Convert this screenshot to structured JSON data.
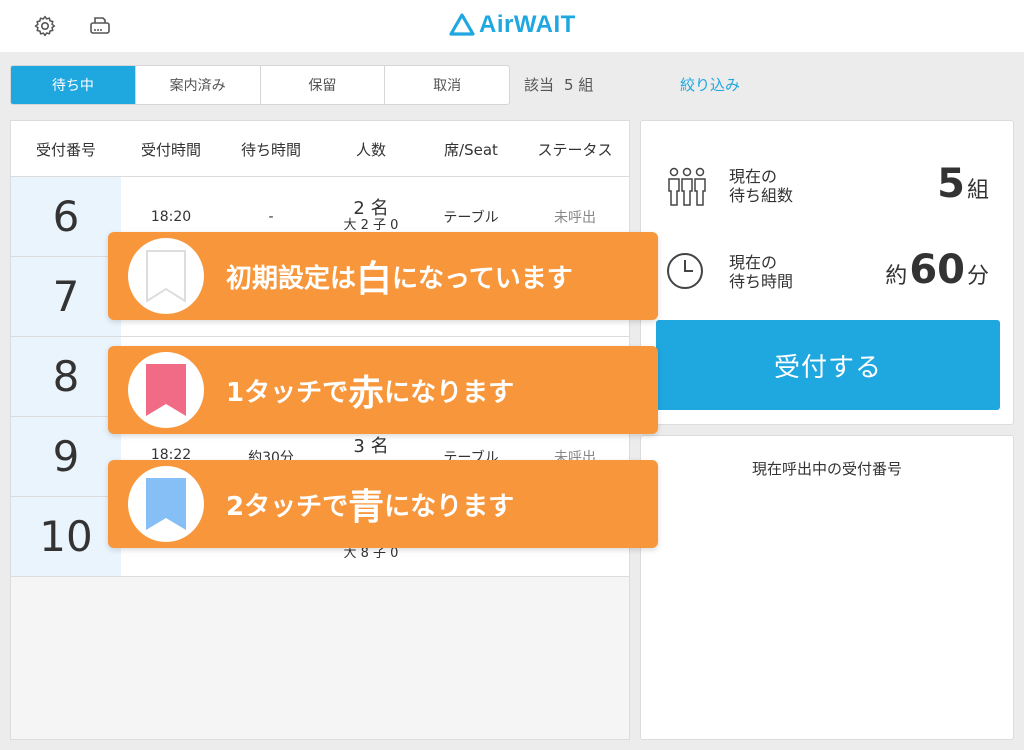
{
  "header": {
    "logo_text": "AirWAIT",
    "settings_icon": "gear-icon",
    "printer_icon": "printer-icon"
  },
  "tabs": [
    {
      "label": "待ち中",
      "active": true
    },
    {
      "label": "案内済み",
      "active": false
    },
    {
      "label": "保留",
      "active": false
    },
    {
      "label": "取消",
      "active": false
    }
  ],
  "count": {
    "label": "該当",
    "value": "5 組"
  },
  "filter_label": "絞り込み",
  "table": {
    "headers": [
      "受付番号",
      "受付時間",
      "待ち時間",
      "人数",
      "席/Seat",
      "ステータス"
    ],
    "rows": [
      {
        "number": "6",
        "time": "18:20",
        "wait": "-",
        "people": "2 名",
        "people_detail": "大 2 子 0",
        "seat": "テーブル",
        "status": "未呼出",
        "flag": "white"
      },
      {
        "number": "7",
        "time": "",
        "wait": "",
        "people": "",
        "people_detail": "",
        "seat": "",
        "status": "",
        "flag": "red"
      },
      {
        "number": "8",
        "time": "",
        "wait": "",
        "people": "",
        "people_detail": "",
        "seat": "",
        "status": "",
        "flag": "red"
      },
      {
        "number": "9",
        "time": "18:22",
        "wait": "約30分",
        "people": "3 名",
        "people_detail": "",
        "seat": "テーブル",
        "status": "未呼出",
        "flag": "blue"
      },
      {
        "number": "10",
        "time": "",
        "wait": "",
        "people": "",
        "people_detail": "大 8 子 0",
        "seat": "",
        "status": "",
        "flag": "white"
      }
    ]
  },
  "summary": {
    "groups_label_1": "現在の",
    "groups_label_2": "待ち組数",
    "groups_value": "5",
    "groups_unit": "組",
    "time_label_1": "現在の",
    "time_label_2": "待ち時間",
    "time_prefix": "約",
    "time_value": "60",
    "time_unit": "分",
    "accept_button": "受付する"
  },
  "calling_title": "現在呼出中の受付番号",
  "callouts": [
    {
      "pre": "初期設定は",
      "big": "白",
      "post": "になっています"
    },
    {
      "pre": "1タッチで",
      "big": "赤",
      "post": "になります"
    },
    {
      "pre": "2タッチで",
      "big": "青",
      "post": "になります"
    }
  ],
  "colors": {
    "accent": "#1fa7e0",
    "callout": "#f7963b",
    "flag_white": "#ffffff",
    "flag_red": "#f26b86",
    "flag_blue": "#86bff5"
  }
}
